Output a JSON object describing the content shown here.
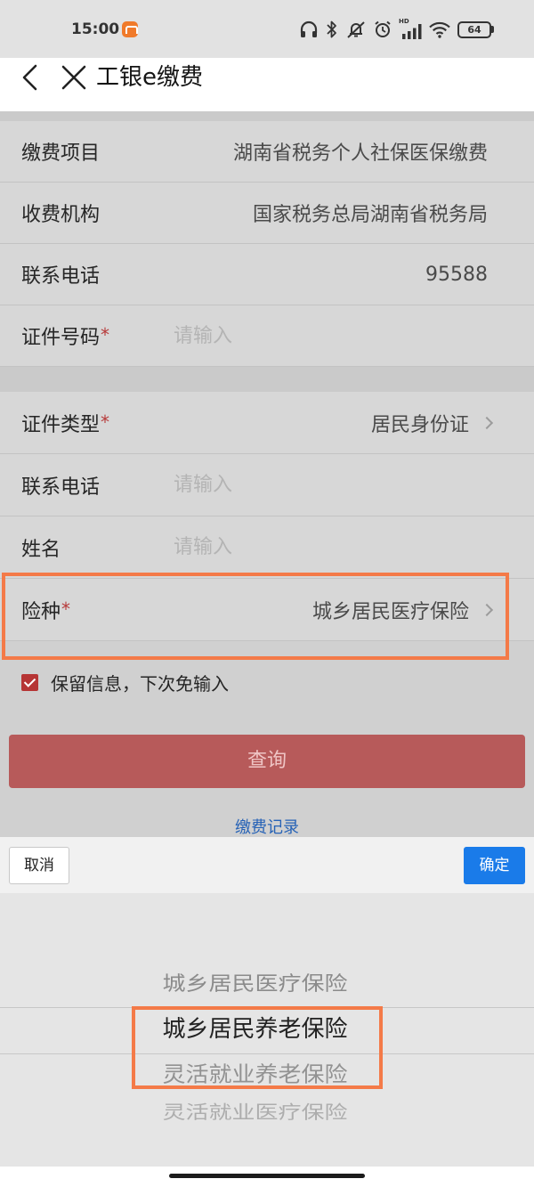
{
  "status_bar": {
    "time": "15:00",
    "network_label": "HD",
    "battery": "64",
    "icons": [
      "app-notification-icon",
      "headphones-icon",
      "bluetooth-icon",
      "mute-icon",
      "alarm-icon",
      "signal-icon",
      "wifi-icon",
      "battery-icon"
    ]
  },
  "header": {
    "title": "工银e缴费",
    "icons": [
      "back-icon",
      "close-icon"
    ]
  },
  "form": {
    "section1": [
      {
        "label": "缴费项目",
        "value": "湖南省税务个人社保医保缴费"
      },
      {
        "label": "收费机构",
        "value": "国家税务总局湖南省税务局"
      },
      {
        "label": "联系电话",
        "value": "95588"
      },
      {
        "label": "证件号码",
        "required": "*",
        "placeholder": "请输入"
      }
    ],
    "section2": [
      {
        "label": "证件类型",
        "required": "*",
        "value": "居民身份证"
      },
      {
        "label": "联系电话",
        "placeholder": "请输入"
      },
      {
        "label": "姓名",
        "placeholder": "请输入"
      },
      {
        "label": "险种",
        "required": "*",
        "value": "城乡居民医疗保险"
      }
    ],
    "remember_info": {
      "label": "保留信息，下次免输入",
      "checked": true
    },
    "query_button": "查询",
    "records_link": "缴费记录"
  },
  "picker": {
    "cancel_label": "取消",
    "confirm_label": "确定",
    "options": [
      "城乡居民医疗保险",
      "城乡居民养老保险",
      "灵活就业养老保险",
      "灵活就业医疗保险"
    ],
    "selected_index": 1
  },
  "colors": {
    "confirm_blue": "#1a7be9",
    "query_button_red": "#b75a5a",
    "checkbox_red": "#b63535",
    "link_blue": "#2662b6",
    "highlight_orange": "#f47a48"
  }
}
